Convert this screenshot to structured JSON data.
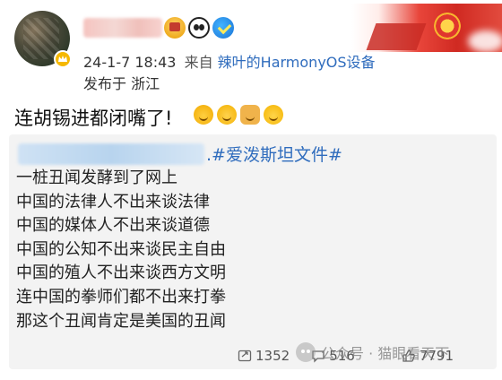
{
  "post": {
    "timestamp": "24-1-7 18:43",
    "source_label": "来自",
    "source_device": "辣叶的HarmonyOS设备",
    "location": "发布于 浙江",
    "text": "连胡锡进都闭嘴了!"
  },
  "quote": {
    "hashtag": ".#爱泼斯坦文件#",
    "lines": [
      "一桩丑闻发酵到了网上",
      "中国的法律人不出来谈法律",
      "中国的媒体人不出来谈道德",
      "中国的公知不出来谈民主自由",
      "中国的殖人不出来谈西方文明",
      "连中国的拳师们都不出来打拳",
      "那这个丑闻肯定是美国的丑闻"
    ]
  },
  "actions": {
    "repost_count": "1352",
    "comment_count": "516",
    "like_count": "7791"
  },
  "watermark": {
    "text": "公众号 · 猫眼看天下"
  },
  "icons": {
    "avatar_badge": "vip-crown-icon",
    "medal": "medal-icon",
    "panda": "panda-icon",
    "verified": "verified-icon",
    "repost": "repost-icon",
    "comment": "comment-icon",
    "like": "like-icon",
    "watermark": "wechat-icon"
  },
  "colors": {
    "link_blue": "#2f6cbd",
    "card_bg": "#f3f3f3",
    "banner_red": "#d02a22"
  }
}
